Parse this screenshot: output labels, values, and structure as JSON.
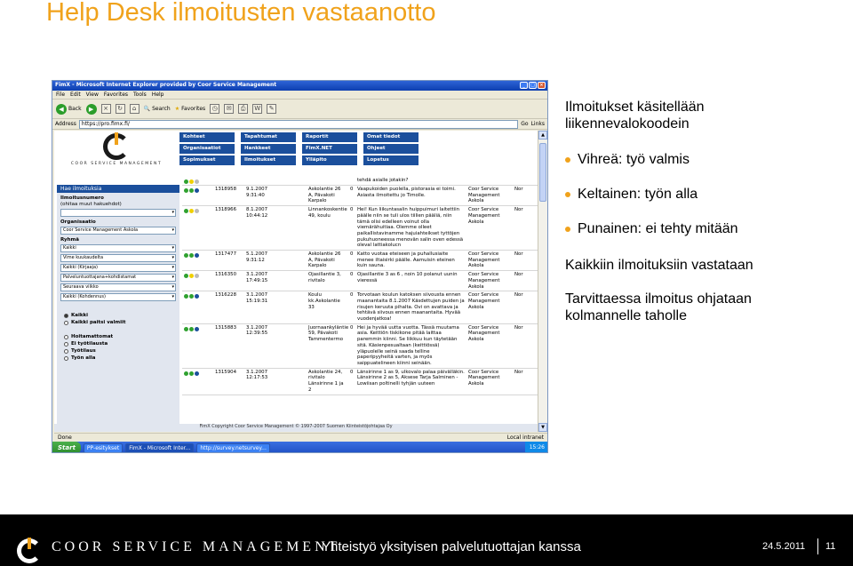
{
  "slide": {
    "title": "Help Desk ilmoitusten vastaanotto",
    "right": {
      "intro_lines": [
        "Ilmoitukset käsitellään",
        "liikennevalokoodein"
      ],
      "bullets": [
        "Vihreä: työ valmis",
        "Keltainen: työn alla",
        "Punainen: ei tehty mitään"
      ],
      "p2": "Kaikkiin ilmoituksiin vastataan",
      "p3_lines": [
        "Tarvittaessa ilmoitus ohjataan",
        "kolmannelle taholle"
      ]
    },
    "footer": {
      "brand": "COOR SERVICE MANAGEMENT",
      "center": "Yhteistyö yksityisen palvelutuottajan kanssa",
      "date": "24.5.2011",
      "page": "11"
    }
  },
  "browser": {
    "title": "FimX - Microsoft Internet Explorer provided by Coor Service Management",
    "menu": [
      "File",
      "Edit",
      "View",
      "Favorites",
      "Tools",
      "Help"
    ],
    "toolbar": {
      "back": "Back",
      "search": "Search",
      "favorites": "Favorites"
    },
    "address_label": "Address",
    "address": "https://pro.fimx.fi/",
    "go": "Go",
    "links": "Links",
    "status_left": "Done",
    "status_right": "Local intranet",
    "taskbar": {
      "start": "Start",
      "tasks": [
        "PP-esitykset",
        "FimX - Microsoft Inter...",
        "http://survey.netsurvey..."
      ],
      "clock": "15:26"
    }
  },
  "app": {
    "logo_text": "COOR SERVICE MANAGEMENT",
    "nav": [
      "Kohteet",
      "Tapahtumat",
      "Raportit",
      "Omat tiedot",
      "Organisaatiot",
      "Hankkeet",
      "FimX.NET",
      "Ohjeet",
      "Sopimukset",
      "Ilmoitukset",
      "Ylläpito",
      "Lopetus"
    ],
    "sidebar": {
      "header": "Hae ilmoituksia",
      "f1_label": "Ilmoitusnumero",
      "f1_note": "(ohitaa muut hakuehdot)",
      "f2_label": "Organisaatio",
      "f2_value": "Coor Service Management Askola",
      "f3_label": "Ryhmä",
      "selects": [
        "Kaikki",
        "Vime kuukaudelta",
        "Kaikki (Kirjaaja)",
        "Palveluntuottajana+kohdistamat",
        "Seuraava viikko",
        "Kaikki (Kohdennus)"
      ],
      "radios": [
        "Kaikki",
        "Kaikki paitsi valmiit",
        "Hoitamattomat",
        "Ei työtilausta",
        "Työtilaus",
        "Työn alla"
      ]
    },
    "rows": [
      {
        "lights": "yellow",
        "no": "",
        "date": "",
        "addr": "",
        "n": "",
        "desc": "tehdä asialle jotakin?",
        "org": "",
        "s": ""
      },
      {
        "lights": "green",
        "no": "1318958",
        "date": "9.1.2007\n9:31:40",
        "addr": "Askolantie 26 A, Pävakoti Karpalo",
        "n": "0",
        "desc": "Vaapukoiden puolella, pistorasia ei toimi. Asiasta ilmoitettu jo Timolle.",
        "org": "Coor Service Management Askola",
        "s": "Nor"
      },
      {
        "lights": "yellow",
        "no": "1318966",
        "date": "8.1.2007\n10:44:12",
        "addr": "Linnankoskentie 49, koulu",
        "n": "0",
        "desc": "Hei! Kun liikuntasalin huippuimuri laitettiin päälle niin se tuli ulos tiilien pääliä, niin tämä olisi edelleen voinut olla viemärähuitiaa. Olemme olleet paikallistavinamme hajuiahteikset tyttöjen pukuhuoneessa menovän salin oven edessä oleval lattiakolucn",
        "org": "Coor Service Management Askola",
        "s": "Nor"
      },
      {
        "lights": "green",
        "no": "1317477",
        "date": "5.1.2007\n9:31:12",
        "addr": "Askolantie 26 A, Pävakoti Karpalo",
        "n": "0",
        "desc": "Katto vuotaa eteiseen ja puhallusiaite menee iltaisirki päälle. Aamuisin eteinen kuin sauna.",
        "org": "Coor Service Management Askola",
        "s": "Nor"
      },
      {
        "lights": "yellow",
        "no": "1316350",
        "date": "3.1.2007\n17:49:15",
        "addr": "Ojasillantie 3, rivitalo",
        "n": "0",
        "desc": "Ojasillantie 3 as 6 , noin 10 polanut uunin vieressä",
        "org": "Coor Service Management Askola",
        "s": "Nor"
      },
      {
        "lights": "green",
        "no": "1316228",
        "date": "3.1.2007\n15:19:31",
        "addr": "Koulu kk.Askolantie 33",
        "n": "0",
        "desc": "Torvotaan koulun katoksen siivousta ennen maanantaita 8.1.2007 Käsdettujen puiden ja risujen keruuta pihalta. Ovi on avattava ja tehtävä siivous ennen maanantaita. Hyvää vuodenjatkoa!",
        "org": "Coor Service Management Askola",
        "s": "Nor"
      },
      {
        "lights": "green",
        "no": "1315883",
        "date": "3.1.2007\n12:39:55",
        "addr": "Juornaankyläntie 59, Pävakoti Tammentermo",
        "n": "0",
        "desc": "Hei ja hyvää uutta vuotta. Tässä muutama asia. Keittiön tiskikone pitää laittaa paremmin kiinni. Se liikkuu kun täytetään sitä. Käsienpesualtaan (keittiössä) yläpuolelle seinä saada telline paperipyyheitä varten, ja myös saippuatelineen kiinni seinään.",
        "org": "Coor Service Management Askola",
        "s": "Nor"
      },
      {
        "lights": "green",
        "no": "1315904",
        "date": "3.1.2007\n12:17:53",
        "addr": "Askolantie 24, rivitalo Länsirinne 1 ja 2",
        "n": "0",
        "desc": "Länsirinne 1 as 9, ulkovalo palaa päivälläkin. Länsirinne 2 as 5, Aksese Tarja Salminen - Lowiisan poltinelli tyhjän uuteen",
        "org": "Coor Service Management Askola",
        "s": "Nor"
      }
    ],
    "footer_text": "FimX Copyright Coor Service Management © 1997-2007 Suomen Kiinteistöjohtajaa Oy"
  },
  "colors": {
    "accent": "#f0a21b",
    "nav_blue": "#1b4f9c",
    "light_green": "#2fa12f",
    "light_yellow": "#f0d000",
    "light_red": "#d22"
  }
}
